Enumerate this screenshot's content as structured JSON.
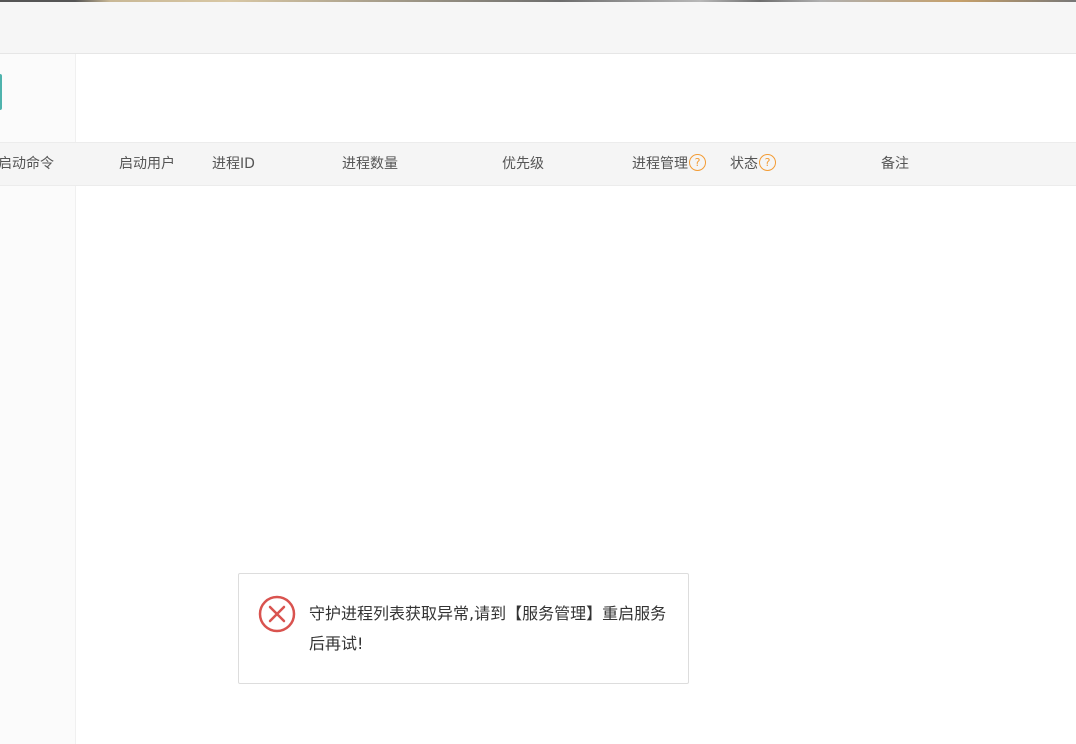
{
  "table": {
    "columns": {
      "start_command": "启动命令",
      "start_user": "启动用户",
      "process_id": "进程ID",
      "process_count": "进程数量",
      "priority": "优先级",
      "process_management": "进程管理",
      "status": "状态",
      "remarks": "备注"
    },
    "help_glyph": "?"
  },
  "toast": {
    "type": "error",
    "icon": "error-circle-x-icon",
    "message": "守护进程列表获取异常,请到【服务管理】重启服务后再试!"
  },
  "colors": {
    "help_icon": "#f39c35",
    "error_icon": "#d9534f",
    "header_bg": "#f5f5f5",
    "accent": "#4fb3ad"
  }
}
